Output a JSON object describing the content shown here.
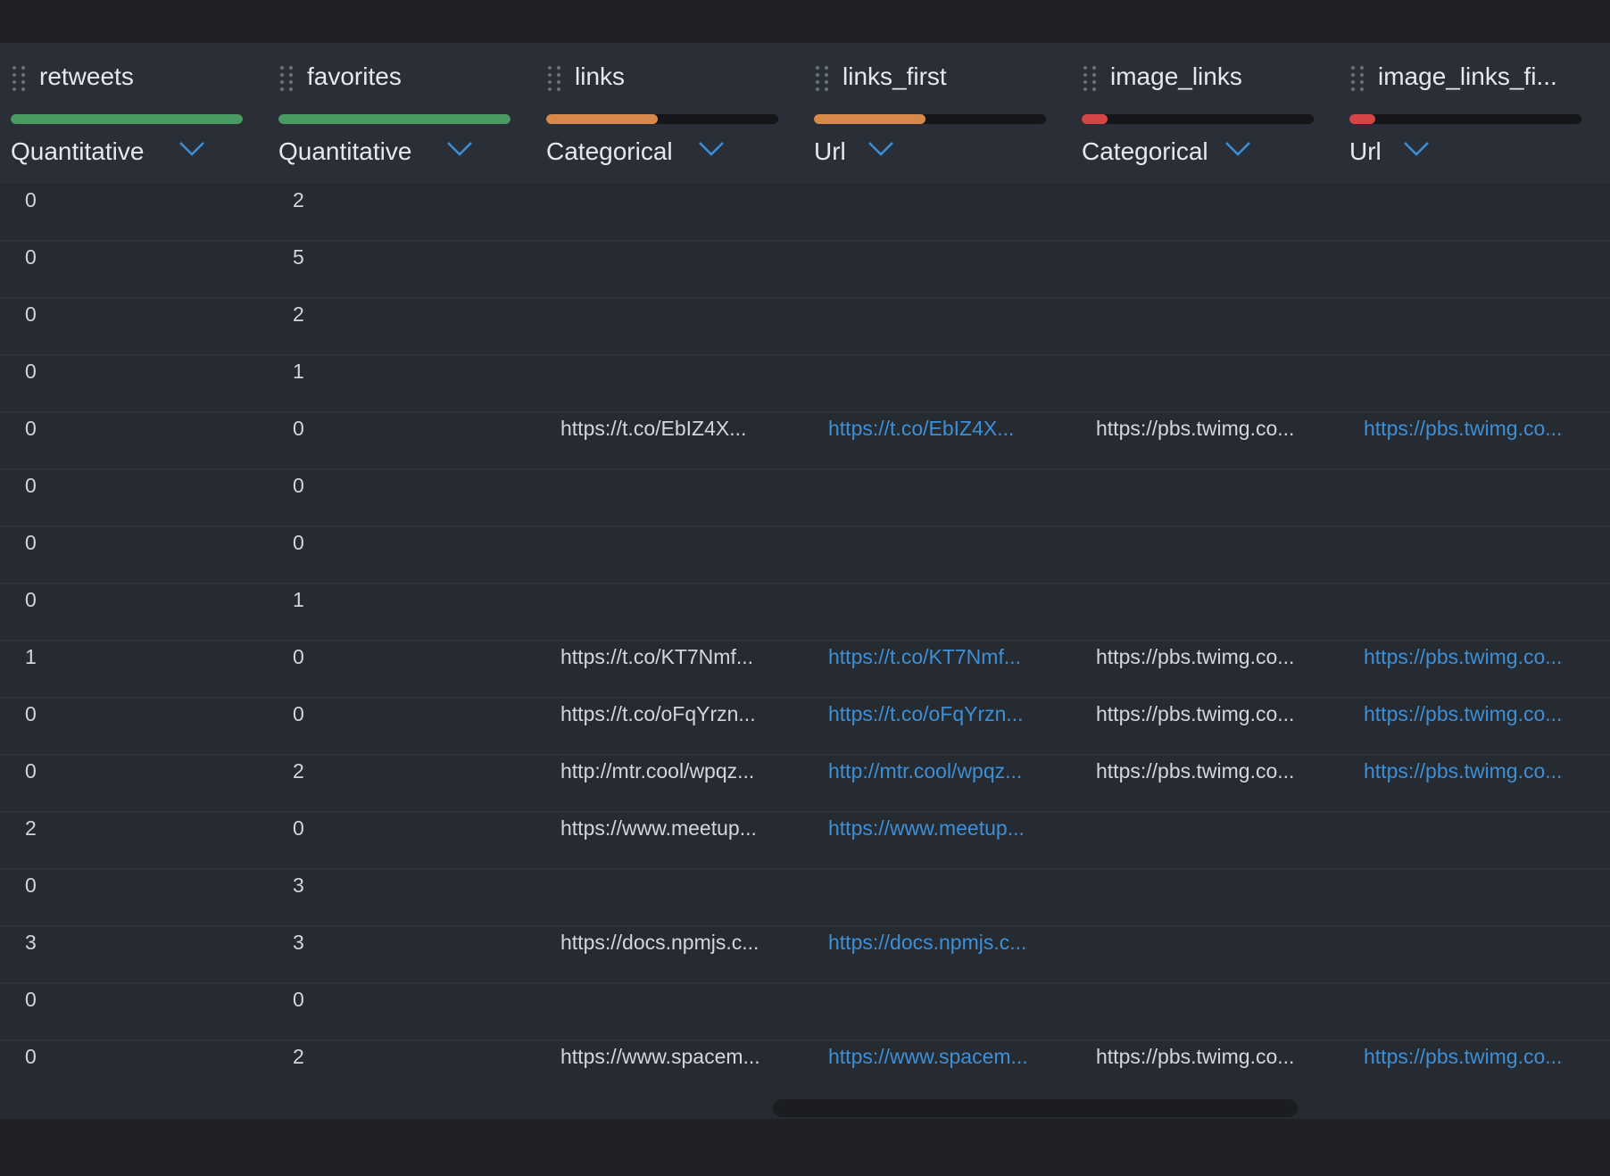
{
  "colors": {
    "background": "#1e2025",
    "grid": "#262a31",
    "header": "#2a2e36",
    "text": "#e6e8eb",
    "link": "#3d8fd6",
    "quality_green": "#4a9a63",
    "quality_orange": "#d6894a",
    "quality_red": "#d64545",
    "quality_track": "#141619"
  },
  "columns": [
    {
      "name": "retweets",
      "type": "Quantitative",
      "quality": 1.0,
      "quality_color": "#4a9a63",
      "is_link": false
    },
    {
      "name": "favorites",
      "type": "Quantitative",
      "quality": 1.0,
      "quality_color": "#4a9a63",
      "is_link": false
    },
    {
      "name": "links",
      "type": "Categorical",
      "quality": 0.48,
      "quality_color": "#d6894a",
      "is_link": false
    },
    {
      "name": "links_first",
      "type": "Url",
      "quality": 0.48,
      "quality_color": "#d6894a",
      "is_link": true
    },
    {
      "name": "image_links",
      "type": "Categorical",
      "quality": 0.11,
      "quality_color": "#d64545",
      "is_link": false
    },
    {
      "name": "image_links_fi...",
      "type": "Url",
      "quality": 0.11,
      "quality_color": "#d64545",
      "is_link": true
    }
  ],
  "icons": {
    "drag_handle": "drag-handle-icon",
    "type_dropdown": "chevron-down-icon"
  },
  "rows": [
    [
      "0",
      "2",
      "",
      "",
      "",
      ""
    ],
    [
      "0",
      "5",
      "",
      "",
      "",
      ""
    ],
    [
      "0",
      "2",
      "",
      "",
      "",
      ""
    ],
    [
      "0",
      "1",
      "",
      "",
      "",
      ""
    ],
    [
      "0",
      "0",
      "https://t.co/EbIZ4X...",
      "https://t.co/EbIZ4X...",
      "https://pbs.twimg.co...",
      "https://pbs.twimg.co..."
    ],
    [
      "0",
      "0",
      "",
      "",
      "",
      ""
    ],
    [
      "0",
      "0",
      "",
      "",
      "",
      ""
    ],
    [
      "0",
      "1",
      "",
      "",
      "",
      ""
    ],
    [
      "1",
      "0",
      "https://t.co/KT7Nmf...",
      "https://t.co/KT7Nmf...",
      "https://pbs.twimg.co...",
      "https://pbs.twimg.co..."
    ],
    [
      "0",
      "0",
      "https://t.co/oFqYrzn...",
      "https://t.co/oFqYrzn...",
      "https://pbs.twimg.co...",
      "https://pbs.twimg.co..."
    ],
    [
      "0",
      "2",
      "http://mtr.cool/wpqz...",
      "http://mtr.cool/wpqz...",
      "https://pbs.twimg.co...",
      "https://pbs.twimg.co..."
    ],
    [
      "2",
      "0",
      "https://www.meetup...",
      "https://www.meetup...",
      "",
      ""
    ],
    [
      "0",
      "3",
      "",
      "",
      "",
      ""
    ],
    [
      "3",
      "3",
      "https://docs.npmjs.c...",
      "https://docs.npmjs.c...",
      "",
      ""
    ],
    [
      "0",
      "0",
      "",
      "",
      "",
      ""
    ],
    [
      "0",
      "2",
      "https://www.spacem...",
      "https://www.spacem...",
      "https://pbs.twimg.co...",
      "https://pbs.twimg.co..."
    ]
  ]
}
